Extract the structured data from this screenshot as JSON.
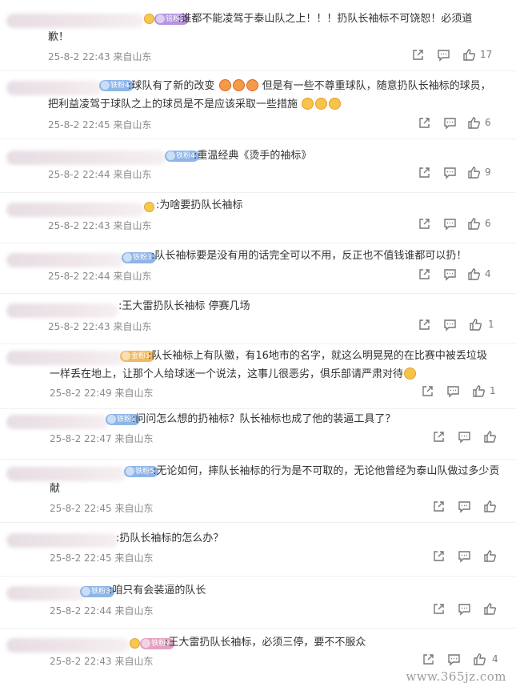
{
  "comments": [
    {
      "badge": "铭粉3",
      "badge_color": "purple",
      "text": ":谁都不能凌驾于泰山队之上！！！扔队长袖标不可饶恕！必须道",
      "text2": "歉！",
      "time": "25-8-2 22:43",
      "location": "来自山东",
      "likes": "17"
    },
    {
      "badge": "铁粉4",
      "badge_color": "blue",
      "text": ":球队有了新的改变",
      "text_b": "但是有一些不尊重球队，随意扔队长袖标的球员，",
      "text2": "把利益凌驾于球队之上的球员是不是应该采取一些措施",
      "time": "25-8-2 22:45",
      "location": "来自山东",
      "likes": "6"
    },
    {
      "badge": "铁粉4",
      "badge_color": "blue",
      "text": ":重温经典《烫手的袖标》",
      "time": "25-8-2 22:44",
      "location": "来自山东",
      "likes": "9"
    },
    {
      "badge": "",
      "badge_color": "",
      "text": ":为啥要扔队长袖标",
      "time": "25-8-2 22:43",
      "location": "来自山东",
      "likes": "6"
    },
    {
      "badge": "铁粉3",
      "badge_color": "blue",
      "text": ":队长袖标要是没有用的话完全可以不用，反正也不值钱谁都可以扔！",
      "time": "25-8-2 22:44",
      "location": "来自山东",
      "likes": "4"
    },
    {
      "badge": "",
      "badge_color": "",
      "text": ":王大雷扔队长袖标 停赛几场",
      "time": "25-8-2 22:43",
      "location": "来自山东",
      "likes": "1"
    },
    {
      "badge": "金粉1",
      "badge_color": "gold",
      "text": ":队长袖标上有队徽，有16地市的名字，就这么明晃晃的在比赛中被丢垃圾",
      "text2": "一样丢在地上，让那个人给球迷一个说法，这事儿很恶劣，俱乐部请严肃对待",
      "time": "25-8-2 22:49",
      "location": "来自山东",
      "likes": "1"
    },
    {
      "badge": "铁粉1",
      "badge_color": "blue",
      "text": ":问问怎么想的扔袖标？队长袖标也成了他的装逼工具了？",
      "time": "25-8-2 22:47",
      "location": "来自山东",
      "likes": ""
    },
    {
      "badge": "铁粉5",
      "badge_color": "blue",
      "text": ":无论如何，摔队长袖标的行为是不可取的，无论他曾经为泰山队做过多少贡",
      "text2": "献",
      "time": "25-8-2 22:45",
      "location": "来自山东",
      "likes": ""
    },
    {
      "badge": "",
      "badge_color": "",
      "text": ":扔队长袖标的怎么办？",
      "time": "25-8-2 22:45",
      "location": "来自山东",
      "likes": ""
    },
    {
      "badge": "铁粉3",
      "badge_color": "blue",
      "text": ":咱只有会装逼的队长",
      "time": "25-8-2 22:44",
      "location": "来自山东",
      "likes": ""
    },
    {
      "badge": "铁粉2",
      "badge_color": "pink",
      "text": ":王大雷扔队长袖标，必须三停，要不不服众",
      "time": "25-8-2 22:43",
      "location": "来自山东",
      "likes": "4"
    }
  ],
  "watermark": "www.365jz.com",
  "icons": {
    "share": "share-icon",
    "reply": "comment-icon",
    "like": "thumbs-up-icon"
  }
}
